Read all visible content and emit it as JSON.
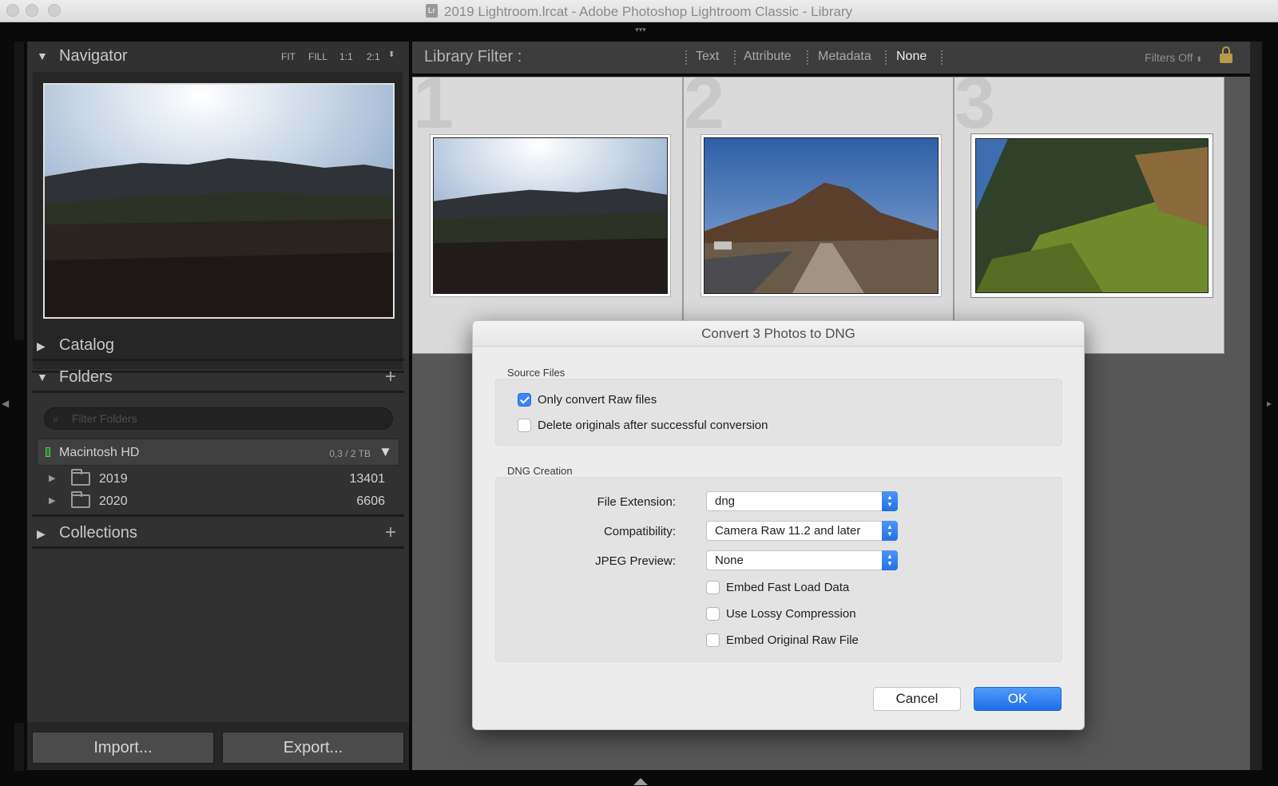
{
  "window": {
    "title": "2019 Lightroom.lrcat - Adobe Photoshop Lightroom Classic - Library",
    "app_badge": "Lr"
  },
  "navigator": {
    "title": "Navigator",
    "zoom_options": [
      "FIT",
      "FILL",
      "1:1",
      "2:1"
    ]
  },
  "catalog": {
    "title": "Catalog"
  },
  "folders": {
    "title": "Folders",
    "search_placeholder": "Filter Folders",
    "volume": {
      "name": "Macintosh HD",
      "size": "0,3 / 2 TB"
    },
    "items": [
      {
        "name": "2019",
        "count": "13401"
      },
      {
        "name": "2020",
        "count": "6606"
      }
    ]
  },
  "collections": {
    "title": "Collections"
  },
  "bottom_buttons": {
    "import": "Import...",
    "export": "Export..."
  },
  "library_filter": {
    "title": "Library Filter :",
    "options": [
      "Text",
      "Attribute",
      "Metadata",
      "None"
    ],
    "selected": "None",
    "filters_off": "Filters Off"
  },
  "grid": {
    "cells": [
      {
        "index": "1"
      },
      {
        "index": "2"
      },
      {
        "index": "3"
      }
    ]
  },
  "dialog": {
    "title": "Convert 3 Photos to DNG",
    "source_files": {
      "label": "Source Files",
      "only_raw": "Only convert Raw files",
      "only_raw_checked": true,
      "delete_originals": "Delete originals after successful conversion",
      "delete_originals_checked": false
    },
    "dng_creation": {
      "label": "DNG Creation",
      "file_extension_label": "File Extension:",
      "file_extension_value": "dng",
      "compatibility_label": "Compatibility:",
      "compatibility_value": "Camera Raw 11.2 and later",
      "jpeg_preview_label": "JPEG Preview:",
      "jpeg_preview_value": "None",
      "embed_fast_load": "Embed Fast Load Data",
      "use_lossy": "Use Lossy Compression",
      "embed_original": "Embed Original Raw File"
    },
    "cancel": "Cancel",
    "ok": "OK"
  },
  "colors": {
    "accent": "#3a86f6",
    "panel": "#313131",
    "grid_bg": "#575757"
  }
}
